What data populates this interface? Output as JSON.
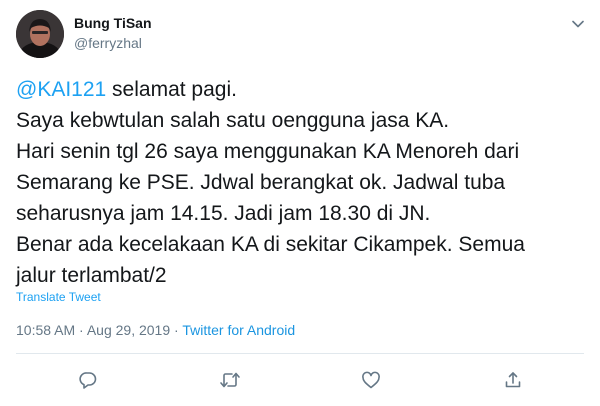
{
  "author": {
    "display_name": "Bung TiSan",
    "handle": "@ferryzhal"
  },
  "tweet": {
    "mention": "@KAI121",
    "text_after_mention": " selamat pagi.\nSaya kebwtulan salah satu oengguna jasa KA.\nHari senin tgl 26 saya menggunakan KA Menoreh dari\nSemarang ke PSE. Jdwal berangkat ok. Jadwal tuba\nseharusnya jam 14.15. Jadi jam 18.30 di JN.\nBenar ada kecelakaan KA di sekitar Cikampek. Semua\njalur terlambat/2"
  },
  "translate_label": "Translate Tweet",
  "meta": {
    "time": "10:58 AM",
    "separator": " · ",
    "date": "Aug 29, 2019",
    "separator2": " · ",
    "source": "Twitter for Android"
  },
  "icons": {
    "avatar": "avatar-photo",
    "more": "chevron-down-icon",
    "reply": "reply-icon",
    "retweet": "retweet-icon",
    "like": "heart-icon",
    "share": "share-icon"
  },
  "colors": {
    "link": "#1da1f2",
    "secondary_text": "#657786",
    "divider": "#e1e8ed"
  }
}
